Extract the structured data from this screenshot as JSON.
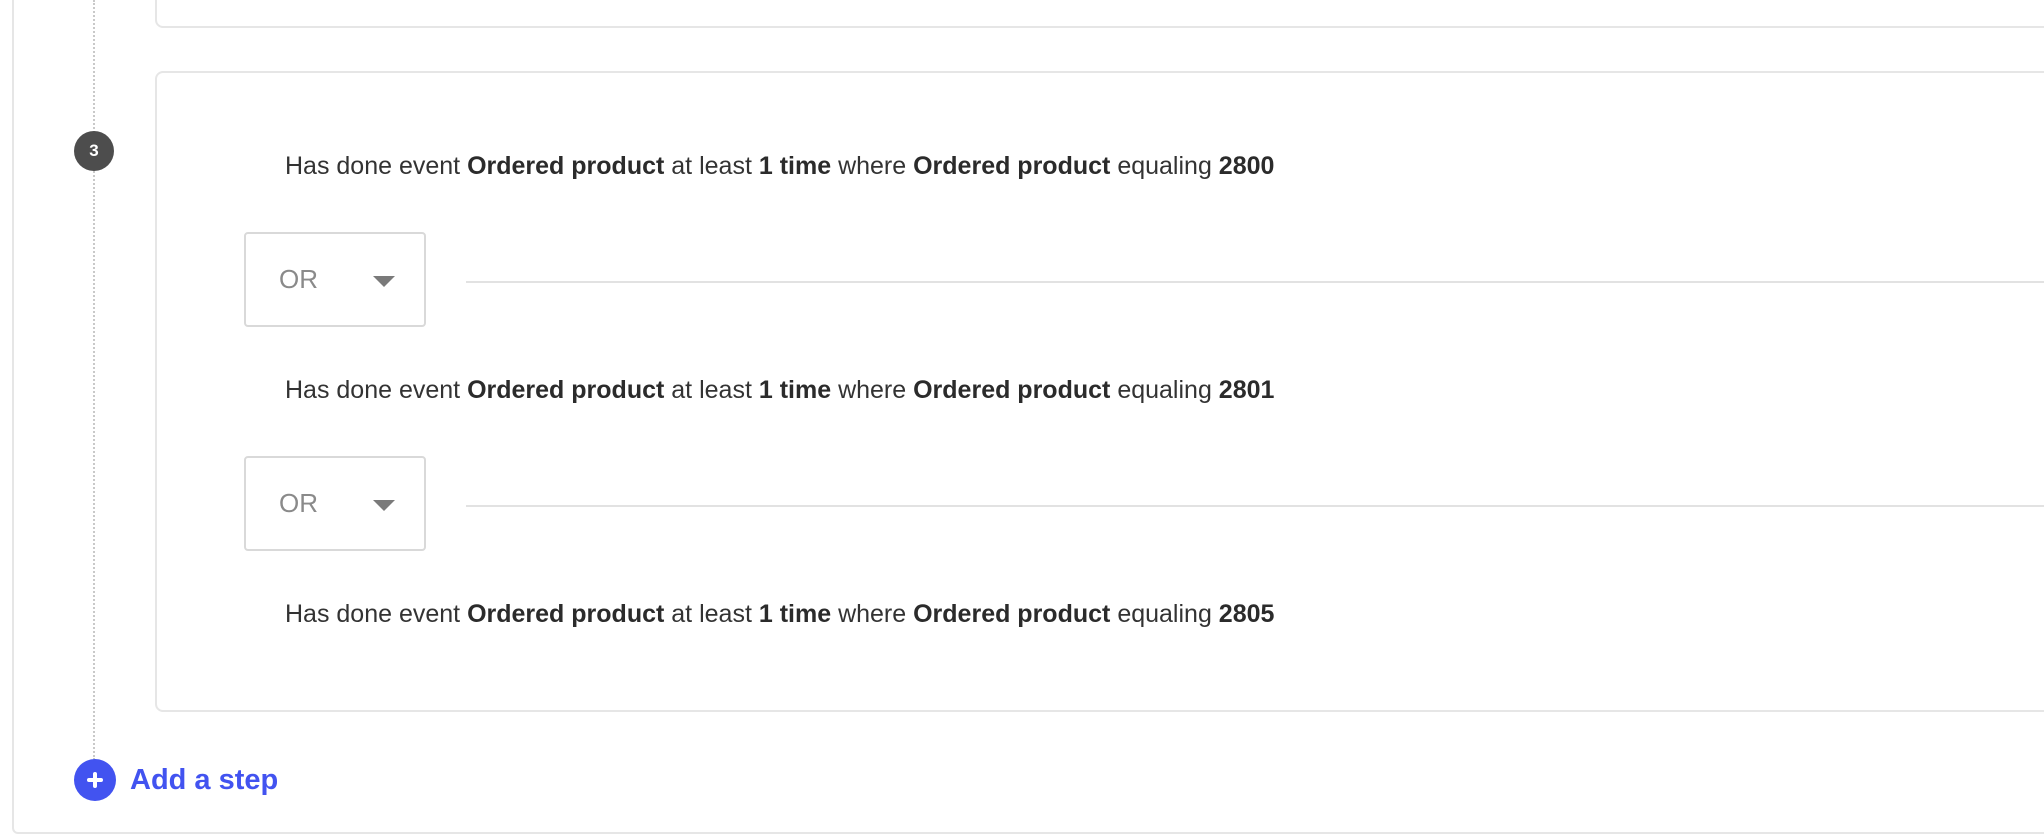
{
  "step": {
    "number": "3",
    "conditions": [
      {
        "prefix": "Has done event",
        "event": "Ordered product",
        "mid1": "at least",
        "count": "1 time",
        "mid2": "where",
        "property": "Ordered product",
        "operator": "equaling",
        "value": "2800"
      },
      {
        "prefix": "Has done event",
        "event": "Ordered product",
        "mid1": "at least",
        "count": "1 time",
        "mid2": "where",
        "property": "Ordered product",
        "operator": "equaling",
        "value": "2801"
      },
      {
        "prefix": "Has done event",
        "event": "Ordered product",
        "mid1": "at least",
        "count": "1 time",
        "mid2": "where",
        "property": "Ordered product",
        "operator": "equaling",
        "value": "2805"
      }
    ],
    "connectors": [
      {
        "label": "OR"
      },
      {
        "label": "OR"
      }
    ]
  },
  "add_step": {
    "label": "Add a step",
    "icon": "plus-circle-icon"
  },
  "colors": {
    "accent": "#4253f0",
    "badge": "#4d4d4d",
    "border": "#e6e6e6"
  }
}
